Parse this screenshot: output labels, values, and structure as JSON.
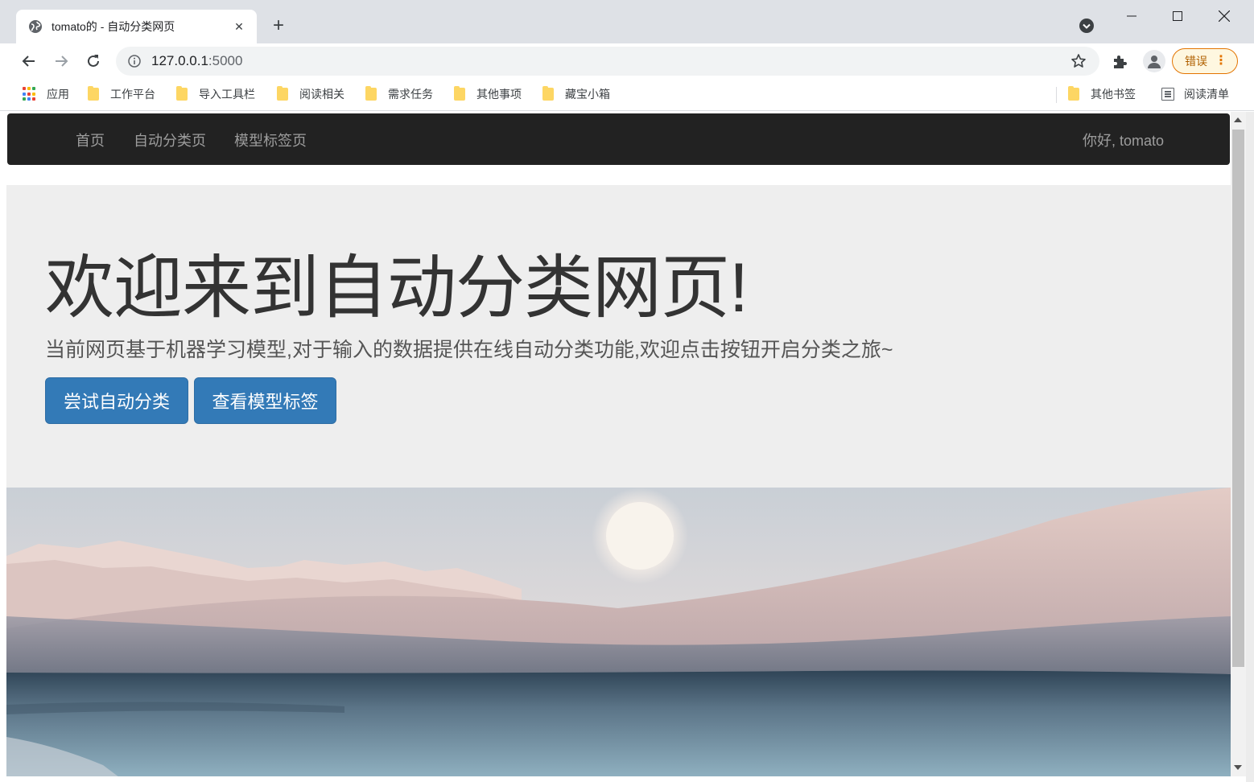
{
  "browser": {
    "tab": {
      "title": "tomato的 - 自动分类网页",
      "favicon": "globe-icon",
      "close_glyph": "✕"
    },
    "new_tab_glyph": "+",
    "address": {
      "host": "127.0.0.1",
      "port": ":5000"
    },
    "error_pill": {
      "label": "错误",
      "menu_glyph": "⋮",
      "border_color": "#e37400"
    },
    "bookmarks": [
      {
        "label": "应用",
        "icon": "apps-grid-icon"
      },
      {
        "label": "工作平台",
        "icon": "folder-icon"
      },
      {
        "label": "导入工具栏",
        "icon": "folder-icon"
      },
      {
        "label": "阅读相关",
        "icon": "folder-icon"
      },
      {
        "label": "需求任务",
        "icon": "folder-icon"
      },
      {
        "label": "其他事项",
        "icon": "folder-icon"
      },
      {
        "label": "藏宝小箱",
        "icon": "folder-icon"
      }
    ],
    "bookmarks_right": [
      {
        "label": "其他书签",
        "icon": "folder-icon"
      },
      {
        "label": "阅读清单",
        "icon": "reading-list-icon"
      }
    ]
  },
  "site": {
    "nav": {
      "links": [
        "首页",
        "自动分类页",
        "模型标签页"
      ],
      "greeting": "你好, tomato",
      "background": "#222222",
      "link_color": "#9d9d9d"
    },
    "jumbotron": {
      "heading": "欢迎来到自动分类网页!",
      "subtitle": "当前网页基于机器学习模型,对于输入的数据提供在线自动分类功能,欢迎点击按钮开启分类之旅~",
      "buttons": {
        "try_classify": "尝试自动分类",
        "view_labels": "查看模型标签"
      },
      "button_color": "#337ab7",
      "background": "#eeeeee"
    }
  }
}
